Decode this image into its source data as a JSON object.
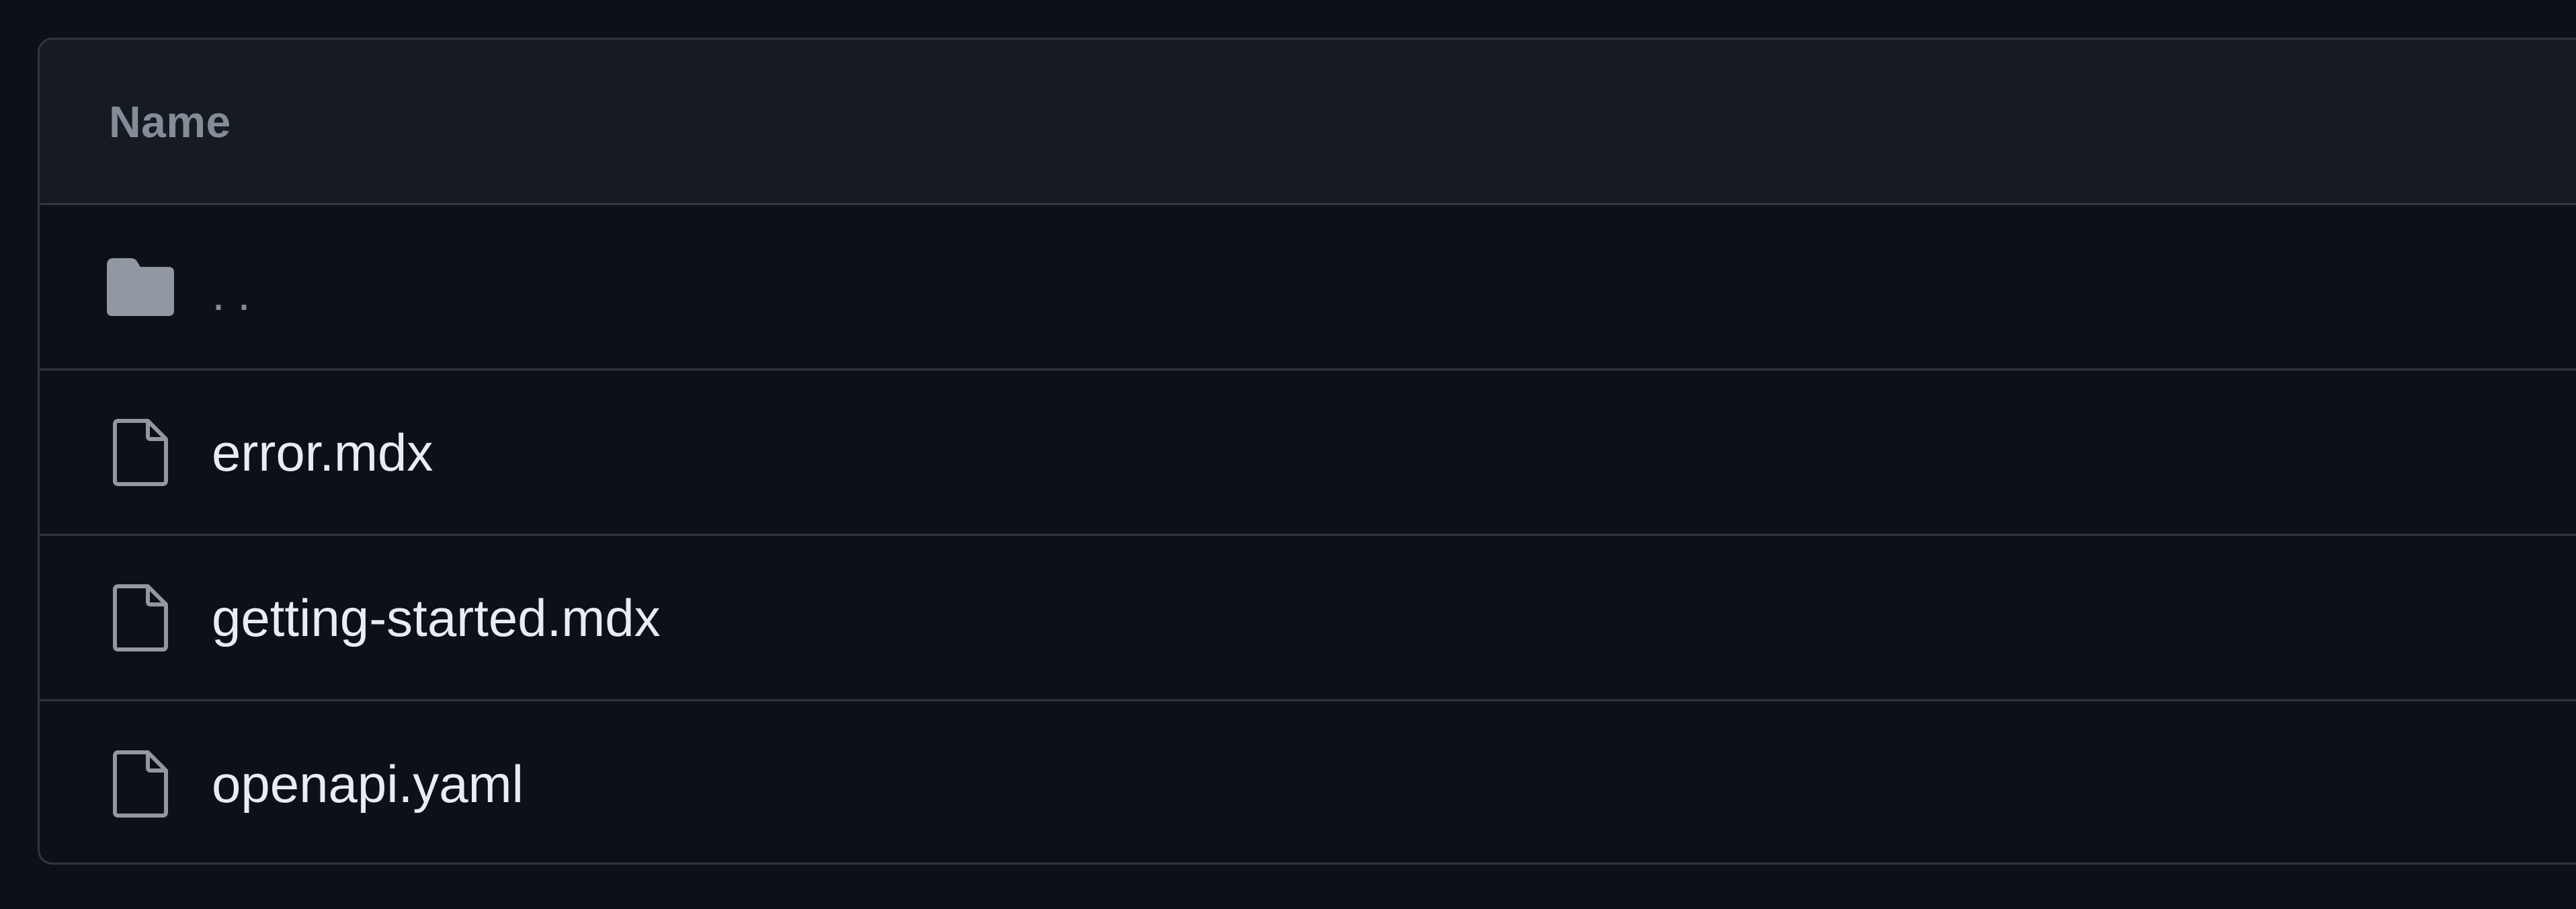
{
  "table": {
    "header": {
      "name_label": "Name"
    },
    "rows": [
      {
        "label": "..",
        "icon": "folder-icon",
        "kind": "parent-directory"
      },
      {
        "label": "error.mdx",
        "icon": "file-icon",
        "kind": "file"
      },
      {
        "label": "getting-started.mdx",
        "icon": "file-icon",
        "kind": "file"
      },
      {
        "label": "openapi.yaml",
        "icon": "file-icon",
        "kind": "file"
      }
    ]
  },
  "colors": {
    "background": "#0d1117",
    "header_background": "#161b22",
    "border": "#30363d",
    "muted_text": "#848d97",
    "primary_text": "#e6edf3",
    "icon": "#9198a1"
  }
}
